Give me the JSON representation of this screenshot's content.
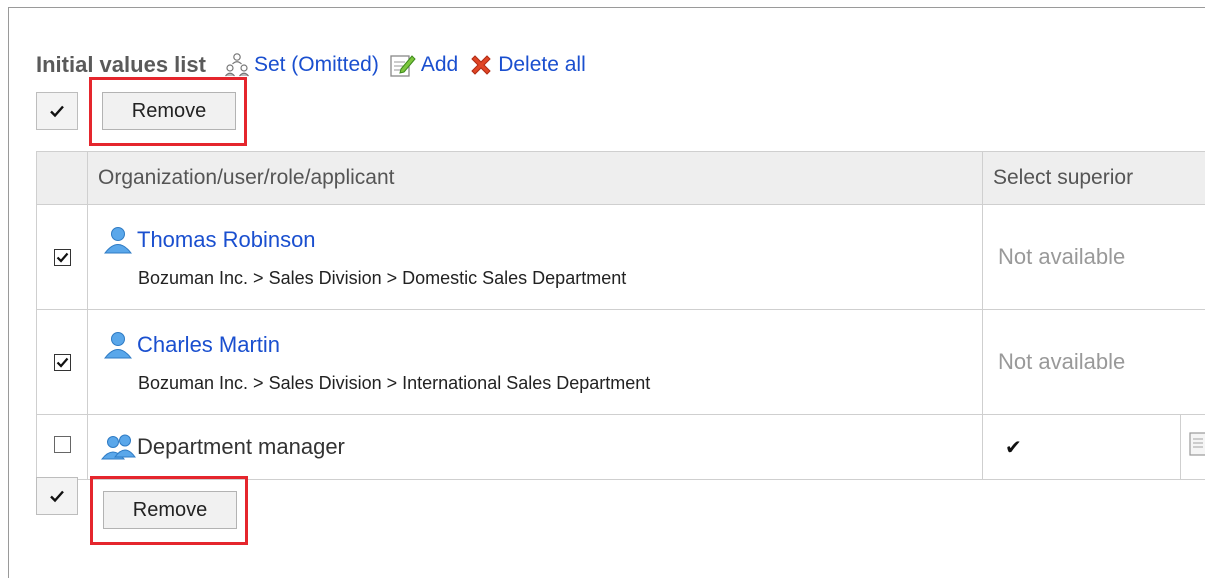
{
  "header": {
    "title": "Initial values list",
    "set_label": "Set (Omitted)",
    "add_label": "Add",
    "delete_all_label": "Delete all"
  },
  "top_actions": {
    "remove_label": "Remove"
  },
  "bottom_actions": {
    "remove_label": "Remove"
  },
  "table": {
    "columns": [
      "Organization/user/role/applicant",
      "Select superior"
    ],
    "rows": [
      {
        "type": "user",
        "checked": true,
        "name": "Thomas Robinson",
        "path": "Bozuman Inc. > Sales Division > Domestic Sales Department",
        "select_superior": "Not available"
      },
      {
        "type": "user",
        "checked": true,
        "name": "Charles Martin",
        "path": "Bozuman Inc. > Sales Division > International Sales Department",
        "select_superior": "Not available"
      },
      {
        "type": "role",
        "checked": false,
        "name": "Department manager",
        "select_superior": "✔"
      }
    ]
  },
  "colors": {
    "link": "#1a4fcf",
    "highlight": "#e5262d",
    "header_bg": "#eeeeee",
    "muted_text": "#999999"
  }
}
